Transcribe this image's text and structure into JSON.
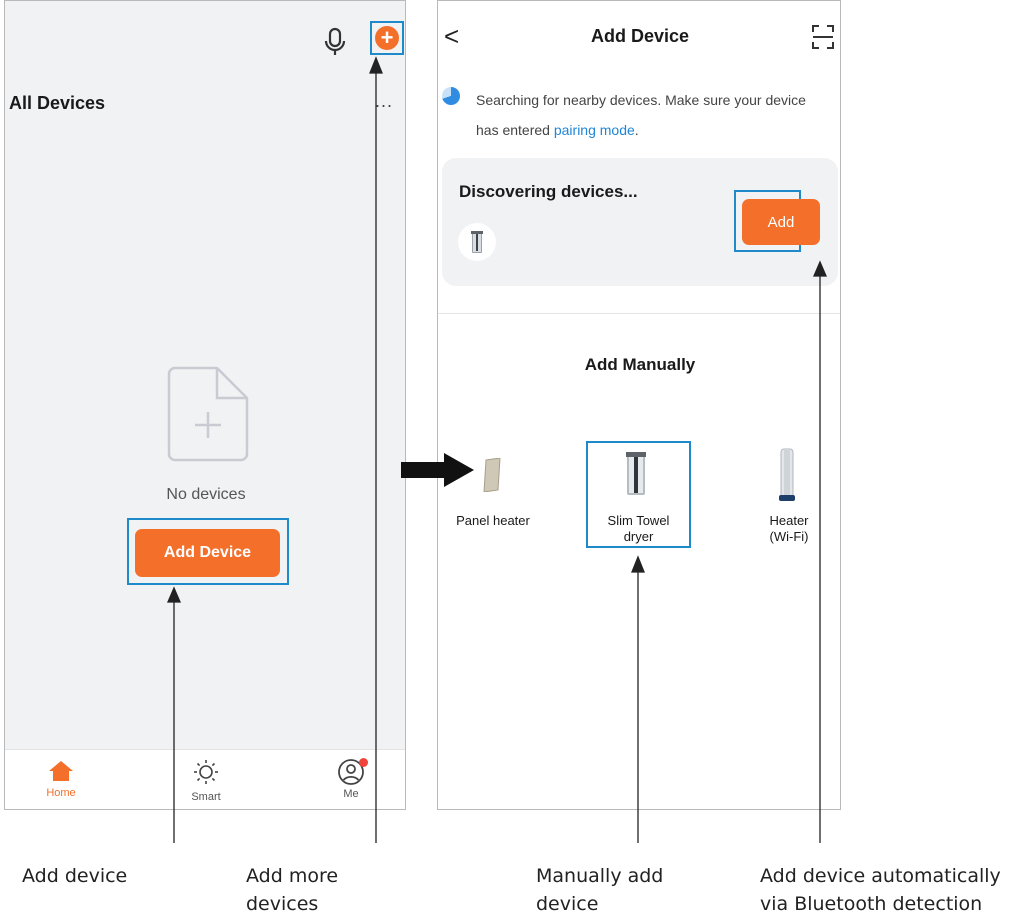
{
  "left_screen": {
    "title": "All Devices",
    "more_label": "...",
    "empty_text": "No devices",
    "add_button": "Add Device",
    "tabs": [
      {
        "label": "Home",
        "icon": "home-icon"
      },
      {
        "label": "Smart",
        "icon": "sun-icon"
      },
      {
        "label": "Me",
        "icon": "user-icon"
      }
    ]
  },
  "right_screen": {
    "back_symbol": "<",
    "title": "Add Device",
    "search_text": "Searching for nearby devices. Make sure your device has entered ",
    "search_link": "pairing mode",
    "search_tail": ".",
    "discovering": "Discovering devices...",
    "add_button": "Add",
    "manual_title": "Add Manually",
    "devices": [
      {
        "line1": "Panel heater",
        "line2": ""
      },
      {
        "line1": "Slim Towel",
        "line2": "dryer"
      },
      {
        "line1": "Heater",
        "line2": "(Wi-Fi)"
      }
    ]
  },
  "captions": [
    {
      "line1": "Add device",
      "line2": ""
    },
    {
      "line1": "Add more",
      "line2": "devices"
    },
    {
      "line1": "Manually add",
      "line2": "device"
    },
    {
      "line1": "Add device automatically",
      "line2": "via Bluetooth detection"
    }
  ],
  "colors": {
    "accent": "#f36f2a",
    "highlight": "#1f8ac9",
    "link": "#1f86d6",
    "badge": "#f0443a"
  }
}
